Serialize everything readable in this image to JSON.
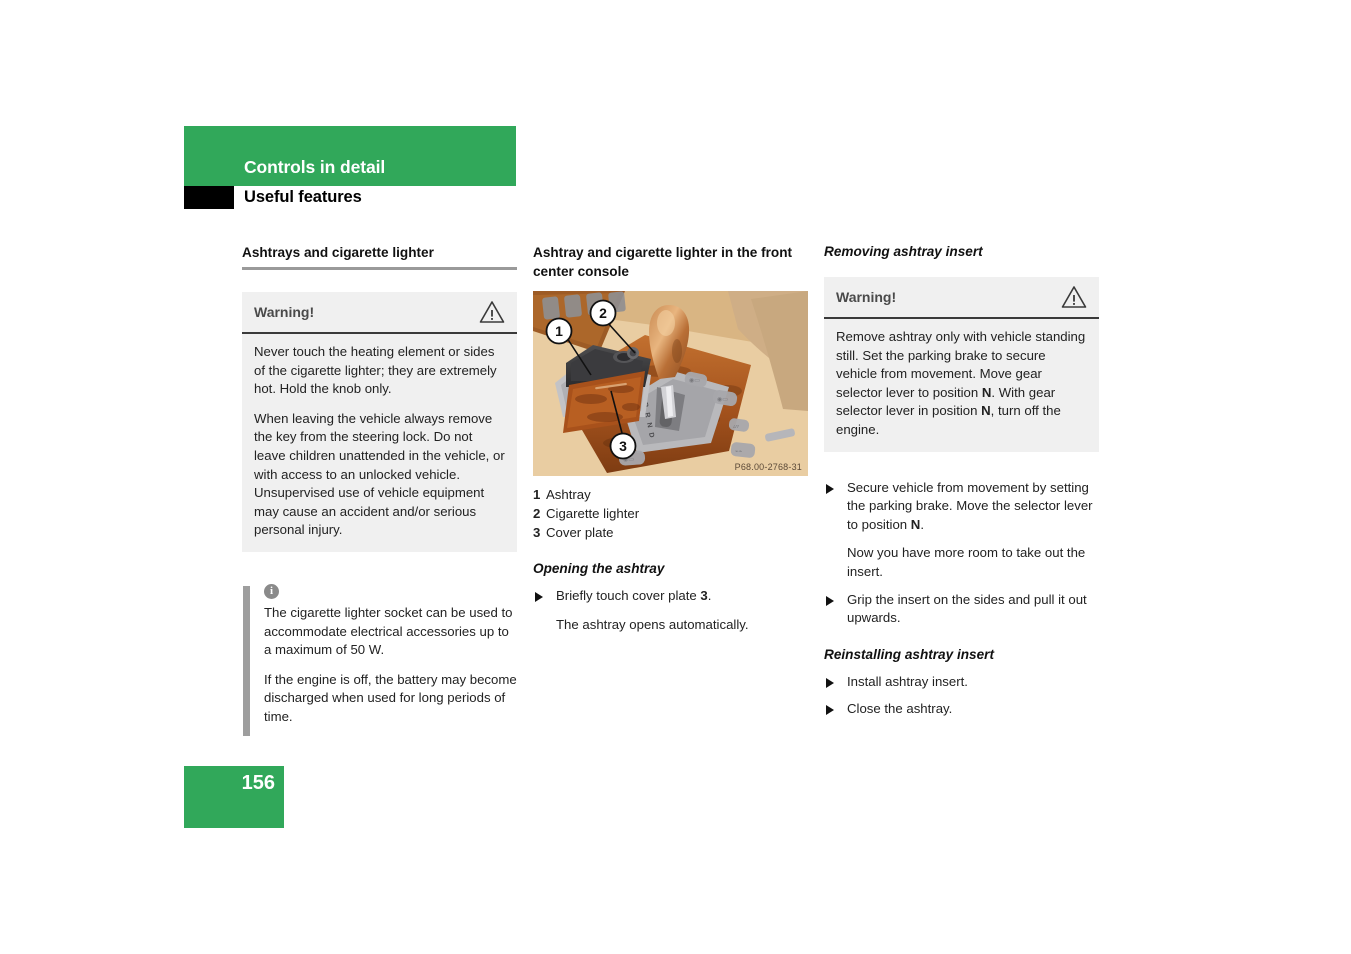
{
  "header": {
    "chapter": "Controls in detail",
    "section": "Useful features",
    "band_color": "#31a85a",
    "tab_color": "#000000"
  },
  "footer": {
    "page_number": "156",
    "band_color": "#31a85a"
  },
  "left_column": {
    "heading": "Ashtrays and cigarette lighter",
    "warning": {
      "title": "Warning!",
      "icon": "warning-triangle-icon",
      "paragraphs": [
        "Never touch the heating element or sides of the cigarette lighter; they are extremely hot. Hold the knob only.",
        "When leaving the vehicle always remove the key from the steering lock. Do not leave children unattended in the vehicle, or with access to an unlocked vehicle. Unsupervised use of vehicle equipment may cause an accident and/or serious personal injury."
      ]
    },
    "info_note": {
      "icon": "info-circle-icon",
      "paragraphs": [
        "The cigarette lighter socket can be used to accommodate electrical accessories up to a maximum of 50 W.",
        "If the engine is off, the battery may become discharged when used for long periods of time."
      ]
    }
  },
  "middle_column": {
    "heading": "Ashtray and cigarette lighter in the front center console",
    "figure": {
      "name": "front-center-console-illustration",
      "code": "P68.00-2768-31",
      "callouts": [
        "1",
        "2",
        "3"
      ]
    },
    "legend": [
      {
        "num": "1",
        "label": "Ashtray"
      },
      {
        "num": "2",
        "label": "Cigarette lighter"
      },
      {
        "num": "3",
        "label": "Cover plate"
      }
    ],
    "subheading": "Opening the ashtray",
    "bullets": [
      {
        "text_before": "Briefly touch cover plate ",
        "bold": "3",
        "text_after": "."
      }
    ],
    "followup": "The ashtray opens automatically."
  },
  "right_column": {
    "heading": "Removing ashtray insert",
    "warning": {
      "title": "Warning!",
      "icon": "warning-triangle-icon",
      "text_parts": [
        {
          "t": "Remove ashtray only with vehicle standing still. Set the parking brake to secure vehicle from movement. Move gear selector lever to position "
        },
        {
          "b": "N"
        },
        {
          "t": ". With gear selector lever in position "
        },
        {
          "b": "N"
        },
        {
          "t": ", turn off the engine."
        }
      ]
    },
    "bullet_1": {
      "text_before": "Secure vehicle from movement by setting the parking brake. Move the selector lever to position ",
      "bold": "N",
      "text_after": "."
    },
    "followup_1": "Now you have more room to take out the insert.",
    "bullet_2": "Grip the insert on the sides and pull it out upwards.",
    "subheading": "Reinstalling ashtray insert",
    "bullet_3": "Install ashtray insert.",
    "bullet_4": "Close the ashtray."
  }
}
